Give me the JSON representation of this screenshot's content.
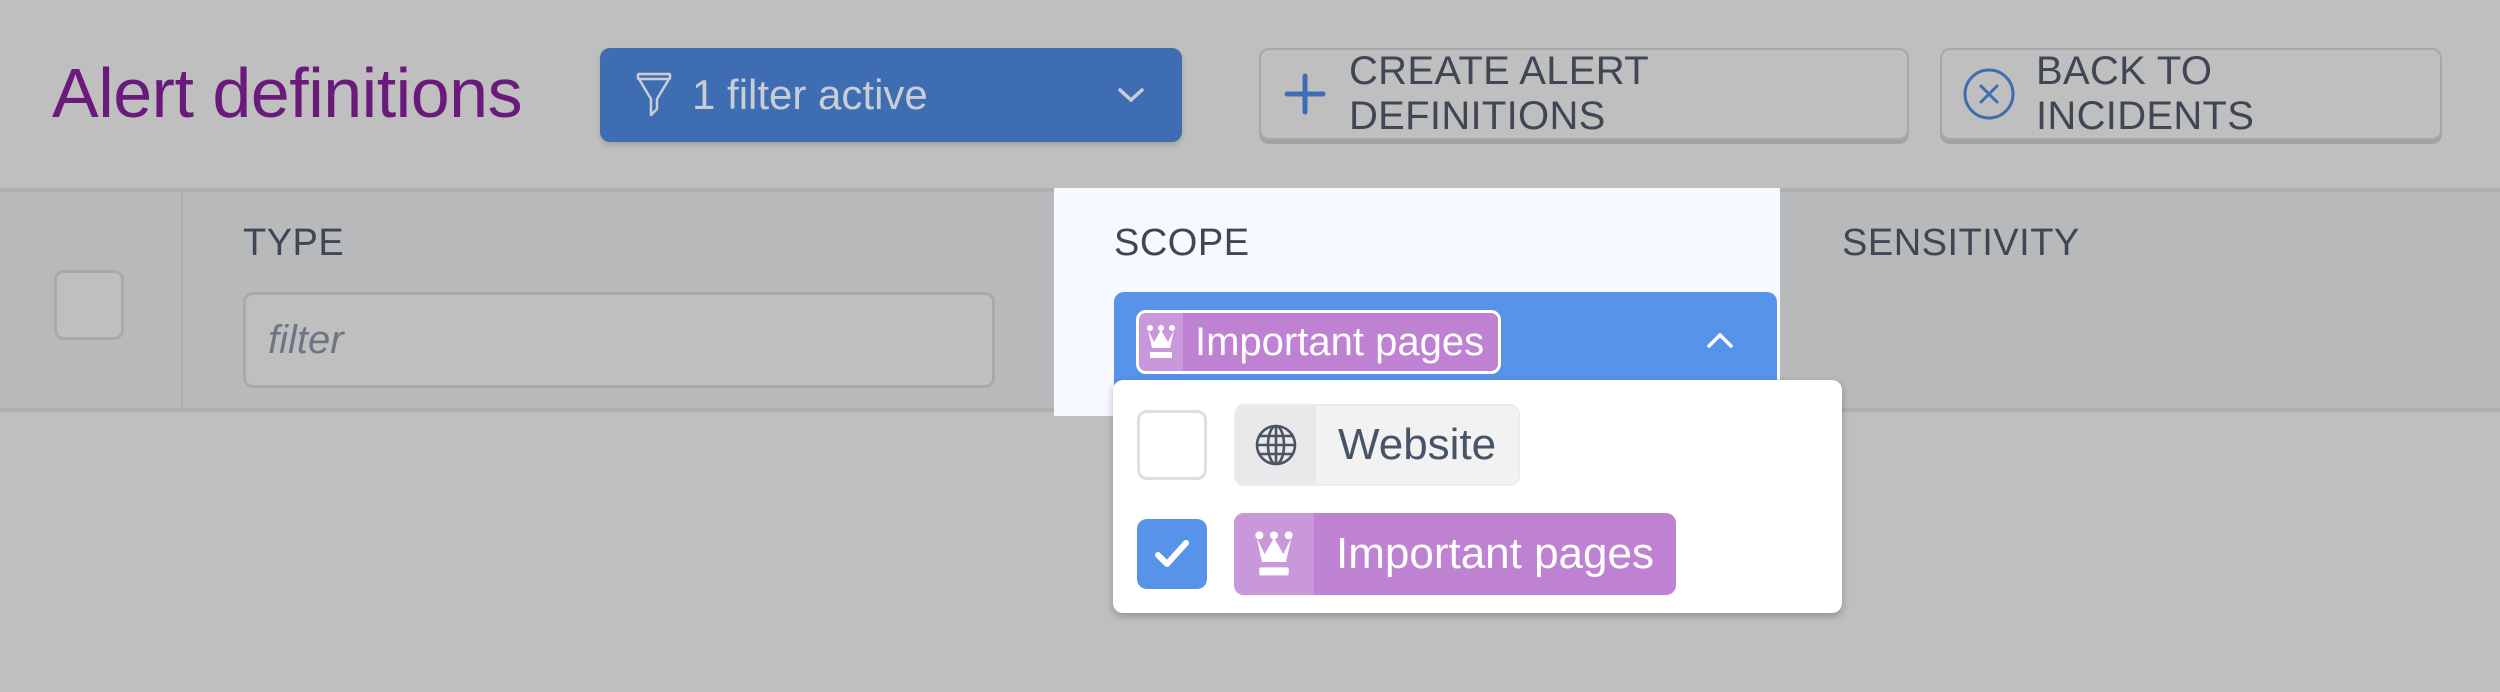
{
  "header": {
    "title": "Alert definitions",
    "filter_button": {
      "label": "1 filter active",
      "icon": "funnel-icon"
    },
    "create_button": {
      "label": "CREATE ALERT DEFINITIONS",
      "icon": "plus-icon"
    },
    "back_button": {
      "label": "BACK TO INCIDENTS",
      "icon": "circle-x-icon"
    }
  },
  "table": {
    "columns": [
      {
        "key": "type",
        "label": "TYPE"
      },
      {
        "key": "scope",
        "label": "SCOPE"
      },
      {
        "key": "sensitivity",
        "label": "SENSITIVITY"
      }
    ],
    "type_filter": {
      "value": "",
      "placeholder": "filter"
    },
    "scope_filter": {
      "selected_label": "Important pages",
      "selected_icon": "crown-icon",
      "expanded": true,
      "options": [
        {
          "label": "Website",
          "icon": "globe-icon",
          "checked": false
        },
        {
          "label": "Important pages",
          "icon": "crown-icon",
          "checked": true
        }
      ]
    }
  },
  "colors": {
    "title": "#6a1a7a",
    "primary_button": "#3f6db1",
    "select_active": "#5793e8",
    "scope_chip": "#bf82d3",
    "overlay_background": "#bfbfbf"
  }
}
